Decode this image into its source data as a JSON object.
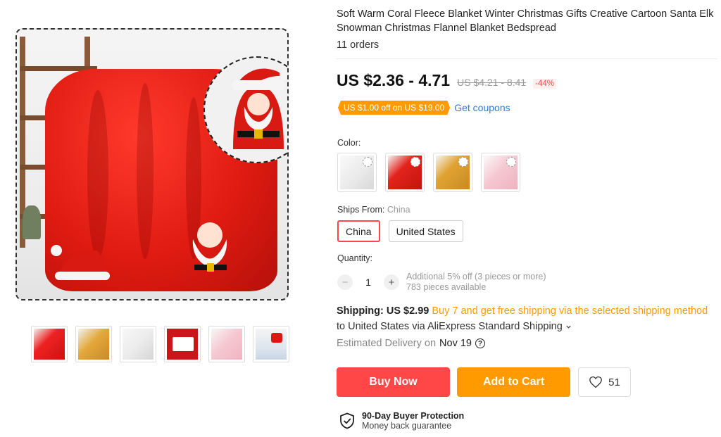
{
  "product": {
    "title": "Soft Warm Coral Fleece Blanket Winter Christmas Gifts Creative Cartoon Santa Elk Snowman Christmas Flannel Blanket Bedspread",
    "orders": "11 orders"
  },
  "price": {
    "current": "US $2.36 - 4.71",
    "original": "US $4.21 - 8.41",
    "discount": "-44%"
  },
  "coupon": {
    "tag": "US $1.00 off on US $19.00",
    "link": "Get coupons"
  },
  "color": {
    "label": "Color:",
    "swatches": [
      {
        "name": "white",
        "color": "#f2f2f2"
      },
      {
        "name": "red",
        "color": "#e3231b"
      },
      {
        "name": "yellow",
        "color": "#e0a332"
      },
      {
        "name": "pink",
        "color": "#f6c9d2"
      }
    ]
  },
  "ships_from": {
    "label": "Ships From:",
    "value": "China",
    "options": [
      "China",
      "United States"
    ]
  },
  "quantity": {
    "label": "Quantity:",
    "minus": "−",
    "plus": "+",
    "value": "1",
    "note": "Additional 5% off (3 pieces or more)",
    "available": "783 pieces available"
  },
  "shipping": {
    "label": "Shipping: US $2.99",
    "promo": "Buy 7 and get free shipping via the selected shipping method",
    "destination": "to United States via AliExpress Standard Shipping",
    "delivery_label": "Estimated Delivery on",
    "delivery_date": "Nov 19",
    "help_icon": "?"
  },
  "actions": {
    "buy": "Buy Now",
    "cart": "Add to Cart",
    "wishlist_count": "51"
  },
  "protection": {
    "title": "90-Day Buyer Protection",
    "subtitle": "Money back guarantee"
  },
  "gallery": {
    "thumbnails": [
      "red",
      "yellow",
      "white",
      "gift",
      "pink",
      "set"
    ]
  },
  "colors": {
    "accent_red": "#ff4747",
    "accent_orange": "#ff9b00",
    "link_blue": "#2e7cd6"
  }
}
